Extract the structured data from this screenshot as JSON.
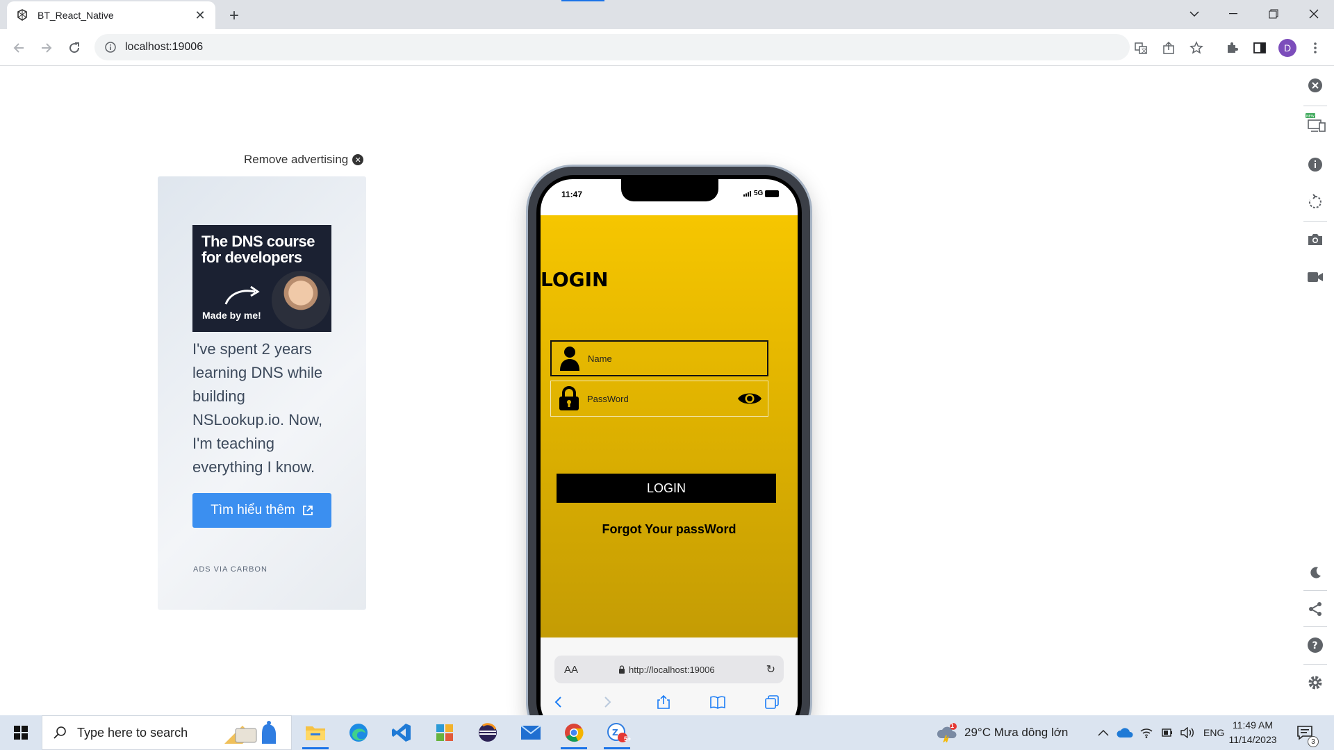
{
  "browser": {
    "tab_title": "BT_React_Native",
    "url": "localhost:19006"
  },
  "ad": {
    "remove_label": "Remove advertising",
    "image_headline": "The DNS course for developers",
    "image_caption": "Made by me!",
    "body": "I've spent 2 years learning DNS while building NSLookup.io. Now, I'm teaching everything I know.",
    "button_label": "Tìm hiểu thêm",
    "via": "ADS VIA CARBON"
  },
  "phone": {
    "time": "11:47",
    "network": "5G",
    "app": {
      "title": "LOGIN",
      "name_placeholder": "Name",
      "password_placeholder": "PassWord",
      "login_button": "LOGIN",
      "forgot_link": "Forgot Your passWord"
    },
    "safari": {
      "text_size_label": "AA",
      "address": "http://localhost:19006"
    }
  },
  "taskbar": {
    "search_placeholder": "Type here to search",
    "weather": "29°C  Mưa dông lớn",
    "language": "ENG",
    "time": "11:49 AM",
    "date": "11/14/2023",
    "notification_count": "3",
    "weather_badge": "1",
    "zalo_badge": "5+"
  },
  "colors": {
    "accent": "#1a73e8",
    "app_gold": "#f6c600",
    "ad_button": "#3b8ff0"
  }
}
